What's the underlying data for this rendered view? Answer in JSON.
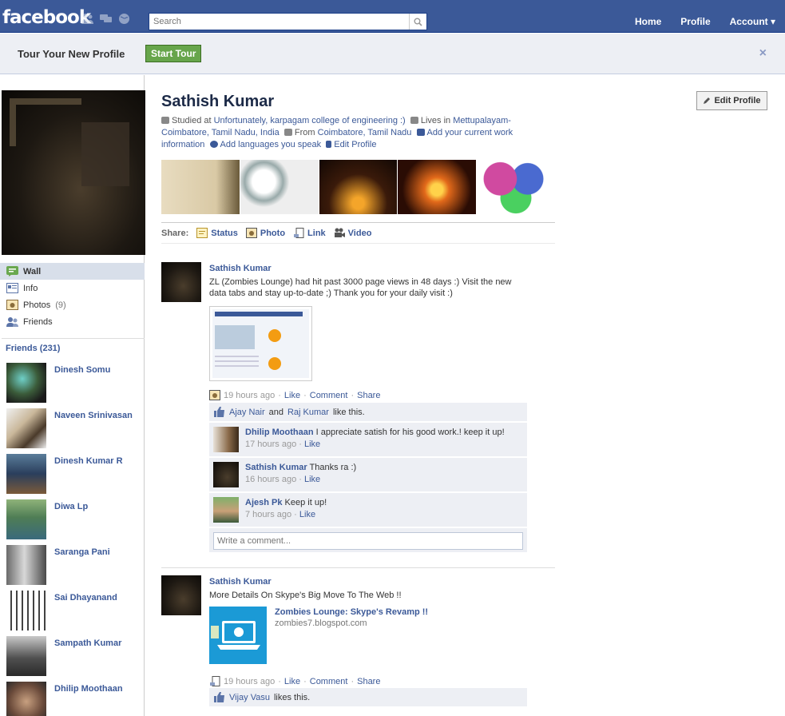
{
  "topbar": {
    "logo": "facebook",
    "search_placeholder": "Search",
    "nav": [
      "Home",
      "Profile",
      "Account ▾"
    ]
  },
  "tour": {
    "text": "Tour Your New Profile",
    "button": "Start Tour",
    "close": "×"
  },
  "left": {
    "nav": [
      {
        "label": "Wall",
        "count": ""
      },
      {
        "label": "Info",
        "count": ""
      },
      {
        "label": "Photos",
        "count": "(9)"
      },
      {
        "label": "Friends",
        "count": ""
      }
    ],
    "friends_header": "Friends (231)",
    "friends": [
      "Dinesh Somu",
      "Naveen Srinivasan",
      "Dinesh Kumar R",
      "Diwa Lp",
      "Saranga Pani",
      "Sai Dhayanand",
      "Sampath Kumar",
      "Dhilip Moothaan"
    ]
  },
  "profile": {
    "name": "Sathish Kumar",
    "edit_button": "Edit Profile",
    "studied_prefix": "Studied at",
    "studied_at": "Unfortunately, karpagam college of engineering :)",
    "lives_prefix": "Lives in",
    "lives_in": "Mettupalayam-Coimbatore, Tamil Nadu, India",
    "from_prefix": "From",
    "from": "Coimbatore, Tamil Nadu",
    "add_work": "Add your current work information",
    "add_languages": "Add languages you speak",
    "edit_profile_link": "Edit Profile"
  },
  "share": {
    "label": "Share:",
    "items": [
      "Status",
      "Photo",
      "Link",
      "Video"
    ]
  },
  "stories": [
    {
      "author": "Sathish Kumar",
      "message": "ZL (Zombies Lounge) had hit past 3000 page views in 48 days :) Visit the new data tabs and stay up-to-date ;) Thank you for your daily visit :)",
      "time": "19 hours ago",
      "actions": [
        "Like",
        "Comment",
        "Share"
      ],
      "likes_a": "Ajay Nair",
      "likes_and": "and",
      "likes_b": "Raj Kumar",
      "likes_suffix": "like this.",
      "comments": [
        {
          "name": "Dhilip Moothaan",
          "text": "I appreciate satish for his good work.! keep it up!",
          "time": "17 hours ago",
          "like": "Like"
        },
        {
          "name": "Sathish Kumar",
          "text": "Thanks ra :)",
          "time": "16 hours ago",
          "like": "Like"
        },
        {
          "name": "Ajesh Pk",
          "text": "Keep it up!",
          "time": "7 hours ago",
          "like": "Like"
        }
      ],
      "write_placeholder": "Write a comment..."
    },
    {
      "author": "Sathish Kumar",
      "message": "More Details On Skype's Big Move To The Web !!",
      "link_title": "Zombies Lounge: Skype's Revamp !!",
      "link_url": "zombies7.blogspot.com",
      "time": "19 hours ago",
      "actions": [
        "Like",
        "Comment",
        "Share"
      ],
      "likes_name": "Vijay Vasu",
      "likes_suffix": "likes this."
    }
  ],
  "colors": {
    "brand": "#3b5998",
    "brand_dark": "#1c2a47",
    "panel": "#edeff4",
    "start_tour": "#67a54b"
  }
}
